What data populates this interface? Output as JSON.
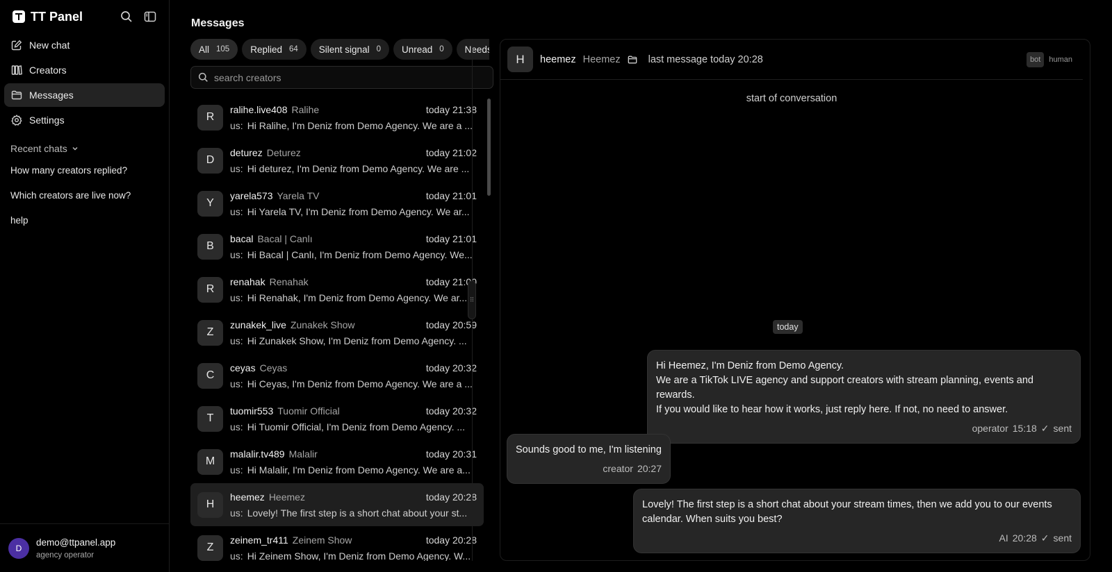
{
  "app": {
    "title": "TT Panel"
  },
  "sidebar": {
    "nav": [
      {
        "label": "New chat",
        "icon": "edit-icon"
      },
      {
        "label": "Creators",
        "icon": "columns-icon"
      },
      {
        "label": "Messages",
        "icon": "folder-icon"
      },
      {
        "label": "Settings",
        "icon": "gear-icon"
      }
    ],
    "recent_title": "Recent chats",
    "recent": [
      "How many creators replied?",
      "Which creators are live now?",
      "help"
    ],
    "user": {
      "initial": "D",
      "email": "demo@ttpanel.app",
      "role": "agency operator"
    }
  },
  "page": {
    "title": "Messages"
  },
  "filters": [
    {
      "label": "All",
      "count": "105"
    },
    {
      "label": "Replied",
      "count": "64"
    },
    {
      "label": "Silent signal",
      "count": "0"
    },
    {
      "label": "Unread",
      "count": "0"
    },
    {
      "label": "Needs",
      "count": ""
    }
  ],
  "search": {
    "placeholder": "search creators"
  },
  "conversations": [
    {
      "initial": "R",
      "handle": "ralihe.live408",
      "name": "Ralihe",
      "time": "today 21:38",
      "who": "us:",
      "preview": "Hi Ralihe, I'm Deniz from Demo Agency. We are a ..."
    },
    {
      "initial": "D",
      "handle": "deturez",
      "name": "Deturez",
      "time": "today 21:02",
      "who": "us:",
      "preview": "Hi deturez, I'm Deniz from Demo Agency. We are ..."
    },
    {
      "initial": "Y",
      "handle": "yarela573",
      "name": "Yarela TV",
      "time": "today 21:01",
      "who": "us:",
      "preview": "Hi Yarela TV, I'm Deniz from Demo Agency. We ar..."
    },
    {
      "initial": "B",
      "handle": "bacal",
      "name": "Bacal | Canlı",
      "time": "today 21:01",
      "who": "us:",
      "preview": "Hi Bacal | Canlı, I'm Deniz from Demo Agency. We..."
    },
    {
      "initial": "R",
      "handle": "renahak",
      "name": "Renahak",
      "time": "today 21:00",
      "who": "us:",
      "preview": "Hi Renahak, I'm Deniz from Demo Agency. We ar..."
    },
    {
      "initial": "Z",
      "handle": "zunakek_live",
      "name": "Zunakek Show",
      "time": "today 20:59",
      "who": "us:",
      "preview": "Hi Zunakek Show, I'm Deniz from Demo Agency. ..."
    },
    {
      "initial": "C",
      "handle": "ceyas",
      "name": "Ceyas",
      "time": "today 20:32",
      "who": "us:",
      "preview": "Hi Ceyas, I'm Deniz from Demo Agency. We are a ..."
    },
    {
      "initial": "T",
      "handle": "tuomir553",
      "name": "Tuomir Official",
      "time": "today 20:32",
      "who": "us:",
      "preview": "Hi Tuomir Official, I'm Deniz from Demo Agency. ..."
    },
    {
      "initial": "M",
      "handle": "malalir.tv489",
      "name": "Malalir",
      "time": "today 20:31",
      "who": "us:",
      "preview": "Hi Malalir, I'm Deniz from Demo Agency. We are a..."
    },
    {
      "initial": "H",
      "handle": "heemez",
      "name": "Heemez",
      "time": "today 20:28",
      "who": "us:",
      "preview": "Lovely! The first step is a short chat about your st..."
    },
    {
      "initial": "Z",
      "handle": "zeinem_tr411",
      "name": "Zeinem Show",
      "time": "today 20:28",
      "who": "us:",
      "preview": "Hi Zeinem Show, I'm Deniz from Demo Agency. W..."
    }
  ],
  "chat": {
    "initial": "H",
    "handle": "heemez",
    "name": "Heemez",
    "last": "last message today 20:28",
    "modes": [
      "bot",
      "human"
    ],
    "start": "start of conversation",
    "day": "today",
    "messages": [
      {
        "lines": [
          "Hi Heemez, I'm Deniz from Demo Agency.",
          "We are a TikTok LIVE agency and support creators with stream planning, events and rewards.",
          "If you would like to hear how it works, just reply here. If not, no need to answer."
        ],
        "sender": "operator",
        "time": "15:18",
        "status": "sent"
      },
      {
        "lines": [
          "Sounds good to me, I'm listening"
        ],
        "sender": "creator",
        "time": "20:27",
        "status": ""
      },
      {
        "lines": [
          "Lovely! The first step is a short chat about your stream times, then we add you to our events",
          "calendar. When suits you best?"
        ],
        "sender": "AI",
        "time": "20:28",
        "status": "sent"
      }
    ]
  }
}
